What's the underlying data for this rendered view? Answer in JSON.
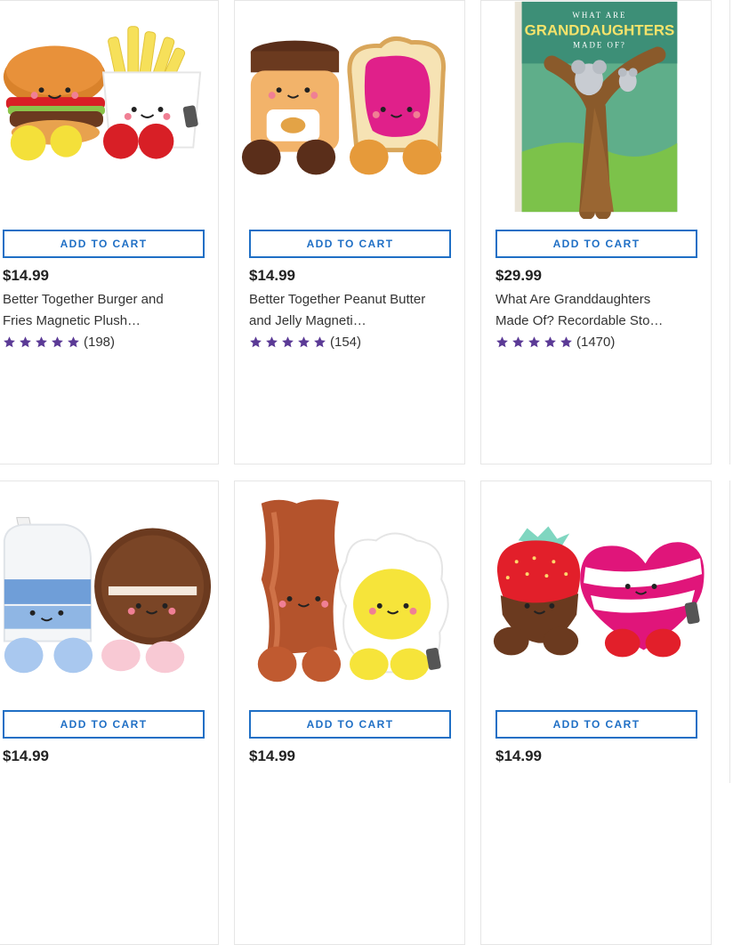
{
  "products": [
    {
      "button_label": "ADD TO CART",
      "price": "$14.99",
      "title_line1": "Better Together Burger and",
      "title_line2": "Fries Magnetic Plush…",
      "rating": 5,
      "review_count": "(198)",
      "image_icon": "burger-fries-plush-image"
    },
    {
      "button_label": "ADD TO CART",
      "price": "$14.99",
      "title_line1": "Better Together Peanut Butter",
      "title_line2": "and Jelly Magneti…",
      "rating": 5,
      "review_count": "(154)",
      "image_icon": "peanut-butter-jelly-plush-image"
    },
    {
      "button_label": "ADD TO CART",
      "price": "$29.99",
      "title_line1": "What Are Granddaughters",
      "title_line2": "Made Of? Recordable Sto…",
      "rating": 5,
      "review_count": "(1470)",
      "image_icon": "granddaughters-book-image",
      "book_cover_text": {
        "line1": "WHAT ARE",
        "line2": "GRANDDAUGHTERS",
        "line3": "MADE OF?"
      }
    },
    {
      "button_label": "ADD TO CART",
      "price": "$14.99",
      "image_icon": "milk-cookie-plush-image"
    },
    {
      "button_label": "ADD TO CART",
      "price": "$14.99",
      "image_icon": "bacon-egg-plush-image"
    },
    {
      "button_label": "ADD TO CART",
      "price": "$14.99",
      "image_icon": "strawberry-heart-plush-image"
    }
  ],
  "colors": {
    "accent_blue": "#1f6fc5",
    "star_purple": "#5b3a96",
    "border": "#e6e6e6"
  }
}
